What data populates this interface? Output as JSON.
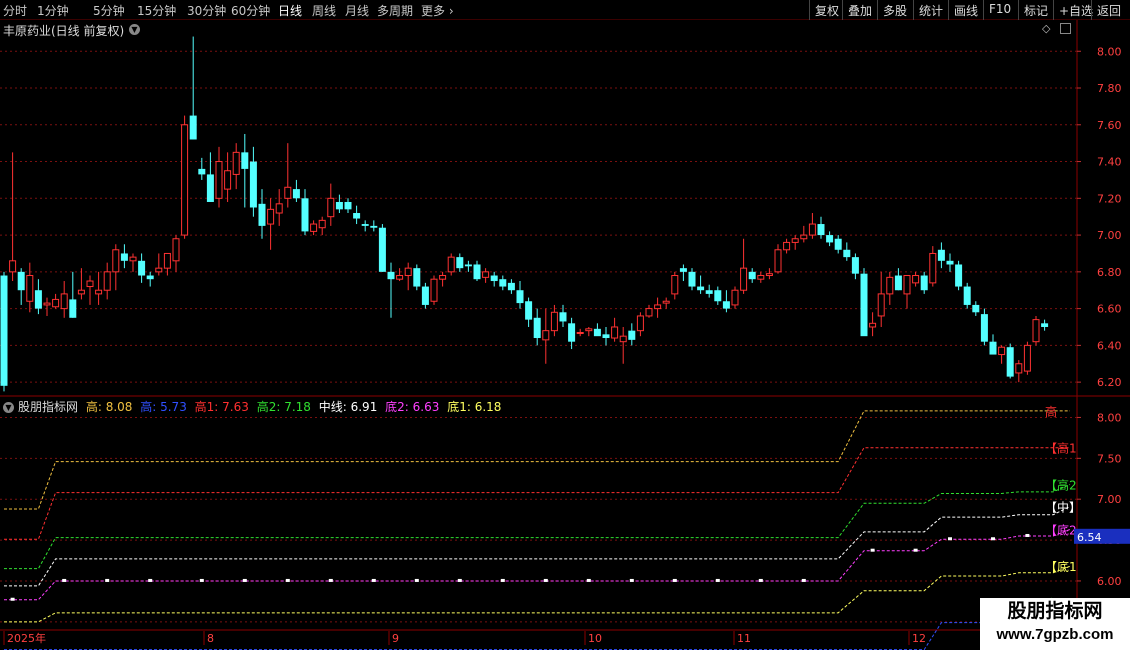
{
  "toolbar": {
    "periods": [
      "分时",
      "1分钟",
      "5分钟",
      "15分钟",
      "30分钟",
      "60分钟",
      "日线",
      "周线",
      "月线",
      "多周期",
      "更多"
    ],
    "active_period": "日线",
    "buttons": [
      "复权",
      "叠加",
      "多股",
      "统计",
      "画线",
      "F10",
      "标记",
      "+自选",
      "返回"
    ]
  },
  "main_chart": {
    "title": "丰原药业(日线 前复权)",
    "price_axis": [
      "8.00",
      "7.80",
      "7.60",
      "7.40",
      "7.20",
      "7.00",
      "6.80",
      "6.60",
      "6.40",
      "6.20"
    ]
  },
  "indicator": {
    "name": "股朋指标网",
    "legend": [
      {
        "label": "高: 8.08",
        "color": "#f0c040"
      },
      {
        "label": "高: 5.73",
        "color": "#3050ff"
      },
      {
        "label": "高1: 7.63",
        "color": "#ff3030"
      },
      {
        "label": "高2: 7.18",
        "color": "#30e030"
      },
      {
        "label": "中线: 6.91",
        "color": "#ffffff"
      },
      {
        "label": "底2: 6.63",
        "color": "#ff40ff"
      },
      {
        "label": "底1: 6.18",
        "color": "#ffff60"
      }
    ],
    "axis": [
      "8.00",
      "7.50",
      "7.00",
      "6.50",
      "6.00",
      "5.50"
    ],
    "line_tags": [
      {
        "text": "高",
        "color": "#ff3030",
        "value": 8.08
      },
      {
        "text": "【高1",
        "color": "#ff3030",
        "value": 7.63
      },
      {
        "text": "【高2",
        "color": "#30e030",
        "value": 7.18
      },
      {
        "text": "【中】",
        "color": "#ffffff",
        "value": 6.91
      },
      {
        "text": "【底2",
        "color": "#ff40ff",
        "value": 6.63
      },
      {
        "text": "【底1",
        "color": "#ffff60",
        "value": 6.18
      },
      {
        "text": "底",
        "color": "#30e030",
        "value": 5.73
      }
    ],
    "current_value": "6.54"
  },
  "time_axis": {
    "labels": [
      "2025年",
      "8",
      "9",
      "10",
      "11",
      "12"
    ]
  },
  "watermark": {
    "name": "股朋指标网",
    "url": "www.7gpzb.com"
  },
  "chart_data": [
    {
      "type": "candlestick",
      "title": "丰原药业(日线 前复权)",
      "ylim": [
        6.13,
        8.17
      ],
      "y_ticks": [
        8.0,
        7.8,
        7.6,
        7.4,
        7.2,
        7.0,
        6.8,
        6.6,
        6.4,
        6.2
      ],
      "x_labels": [
        "2025年",
        "8",
        "9",
        "10",
        "11",
        "12"
      ],
      "up_color": "#ff3232",
      "down_color": "#54ffff",
      "ohlc": [
        [
          6.78,
          6.8,
          6.15,
          6.18
        ],
        [
          6.8,
          7.45,
          6.75,
          6.86
        ],
        [
          6.8,
          6.82,
          6.62,
          6.7
        ],
        [
          6.64,
          6.85,
          6.58,
          6.78
        ],
        [
          6.7,
          6.76,
          6.57,
          6.6
        ],
        [
          6.62,
          6.66,
          6.56,
          6.63
        ],
        [
          6.61,
          6.68,
          6.6,
          6.65
        ],
        [
          6.6,
          6.75,
          6.55,
          6.68
        ],
        [
          6.65,
          6.8,
          6.55,
          6.55
        ],
        [
          6.68,
          6.82,
          6.65,
          6.7
        ],
        [
          6.72,
          6.78,
          6.62,
          6.75
        ],
        [
          6.68,
          6.8,
          6.62,
          6.7
        ],
        [
          6.7,
          6.85,
          6.65,
          6.8
        ],
        [
          6.8,
          6.95,
          6.7,
          6.92
        ],
        [
          6.9,
          6.95,
          6.82,
          6.86
        ],
        [
          6.86,
          6.9,
          6.8,
          6.88
        ],
        [
          6.86,
          6.9,
          6.74,
          6.78
        ],
        [
          6.78,
          6.8,
          6.72,
          6.76
        ],
        [
          6.8,
          6.9,
          6.78,
          6.82
        ],
        [
          6.82,
          6.9,
          6.78,
          6.9
        ],
        [
          6.86,
          7.0,
          6.8,
          6.98
        ],
        [
          7.0,
          7.65,
          6.98,
          7.6
        ],
        [
          7.65,
          8.08,
          7.52,
          7.52
        ],
        [
          7.36,
          7.42,
          7.3,
          7.33
        ],
        [
          7.33,
          7.45,
          7.18,
          7.18
        ],
        [
          7.2,
          7.48,
          7.15,
          7.4
        ],
        [
          7.25,
          7.45,
          7.18,
          7.35
        ],
        [
          7.33,
          7.5,
          7.25,
          7.45
        ],
        [
          7.45,
          7.55,
          7.15,
          7.36
        ],
        [
          7.4,
          7.48,
          7.1,
          7.15
        ],
        [
          7.17,
          7.25,
          6.98,
          7.05
        ],
        [
          7.06,
          7.2,
          6.92,
          7.14
        ],
        [
          7.12,
          7.25,
          7.05,
          7.17
        ],
        [
          7.2,
          7.5,
          7.15,
          7.26
        ],
        [
          7.25,
          7.3,
          7.18,
          7.2
        ],
        [
          7.2,
          7.25,
          7.0,
          7.02
        ],
        [
          7.02,
          7.08,
          7.0,
          7.06
        ],
        [
          7.04,
          7.1,
          7.0,
          7.08
        ],
        [
          7.1,
          7.28,
          7.05,
          7.2
        ],
        [
          7.18,
          7.22,
          7.12,
          7.14
        ],
        [
          7.18,
          7.2,
          7.12,
          7.14
        ],
        [
          7.12,
          7.16,
          7.06,
          7.09
        ],
        [
          7.06,
          7.08,
          7.02,
          7.05
        ],
        [
          7.05,
          7.08,
          7.02,
          7.04
        ],
        [
          7.04,
          7.06,
          6.8,
          6.8
        ],
        [
          6.8,
          6.85,
          6.55,
          6.76
        ],
        [
          6.76,
          6.82,
          6.75,
          6.78
        ],
        [
          6.78,
          6.85,
          6.7,
          6.82
        ],
        [
          6.82,
          6.84,
          6.7,
          6.72
        ],
        [
          6.72,
          6.74,
          6.6,
          6.62
        ],
        [
          6.64,
          6.78,
          6.62,
          6.76
        ],
        [
          6.76,
          6.8,
          6.72,
          6.78
        ],
        [
          6.8,
          6.9,
          6.78,
          6.88
        ],
        [
          6.88,
          6.9,
          6.8,
          6.82
        ],
        [
          6.84,
          6.86,
          6.8,
          6.83
        ],
        [
          6.84,
          6.86,
          6.75,
          6.76
        ],
        [
          6.77,
          6.82,
          6.74,
          6.8
        ],
        [
          6.78,
          6.8,
          6.72,
          6.75
        ],
        [
          6.76,
          6.78,
          6.7,
          6.72
        ],
        [
          6.74,
          6.76,
          6.68,
          6.7
        ],
        [
          6.7,
          6.75,
          6.6,
          6.63
        ],
        [
          6.64,
          6.66,
          6.5,
          6.54
        ],
        [
          6.55,
          6.6,
          6.4,
          6.44
        ],
        [
          6.43,
          6.6,
          6.3,
          6.48
        ],
        [
          6.48,
          6.62,
          6.45,
          6.58
        ],
        [
          6.58,
          6.62,
          6.5,
          6.53
        ],
        [
          6.52,
          6.55,
          6.38,
          6.42
        ],
        [
          6.47,
          6.49,
          6.45,
          6.47
        ],
        [
          6.48,
          6.5,
          6.45,
          6.49
        ],
        [
          6.49,
          6.52,
          6.46,
          6.45
        ],
        [
          6.46,
          6.5,
          6.4,
          6.44
        ],
        [
          6.44,
          6.55,
          6.42,
          6.5
        ],
        [
          6.42,
          6.5,
          6.3,
          6.45
        ],
        [
          6.48,
          6.52,
          6.4,
          6.43
        ],
        [
          6.48,
          6.58,
          6.45,
          6.56
        ],
        [
          6.56,
          6.62,
          6.55,
          6.6
        ],
        [
          6.6,
          6.66,
          6.55,
          6.62
        ],
        [
          6.63,
          6.66,
          6.6,
          6.64
        ],
        [
          6.68,
          6.8,
          6.65,
          6.78
        ],
        [
          6.82,
          6.84,
          6.75,
          6.8
        ],
        [
          6.8,
          6.82,
          6.7,
          6.72
        ],
        [
          6.72,
          6.78,
          6.68,
          6.7
        ],
        [
          6.7,
          6.73,
          6.66,
          6.68
        ],
        [
          6.7,
          6.72,
          6.62,
          6.64
        ],
        [
          6.64,
          6.7,
          6.58,
          6.6
        ],
        [
          6.62,
          6.72,
          6.6,
          6.7
        ],
        [
          6.7,
          6.98,
          6.68,
          6.82
        ],
        [
          6.8,
          6.82,
          6.74,
          6.76
        ],
        [
          6.76,
          6.8,
          6.74,
          6.78
        ],
        [
          6.78,
          6.82,
          6.76,
          6.79
        ],
        [
          6.8,
          6.95,
          6.79,
          6.92
        ],
        [
          6.92,
          6.98,
          6.9,
          6.96
        ],
        [
          6.96,
          7.0,
          6.92,
          6.98
        ],
        [
          6.98,
          7.05,
          6.96,
          7.0
        ],
        [
          7.0,
          7.12,
          6.98,
          7.06
        ],
        [
          7.06,
          7.1,
          6.98,
          7.0
        ],
        [
          7.0,
          7.02,
          6.94,
          6.96
        ],
        [
          6.98,
          7.0,
          6.9,
          6.92
        ],
        [
          6.92,
          6.96,
          6.86,
          6.88
        ],
        [
          6.88,
          6.9,
          6.76,
          6.79
        ],
        [
          6.79,
          6.82,
          6.48,
          6.45
        ],
        [
          6.5,
          6.58,
          6.45,
          6.52
        ],
        [
          6.56,
          6.8,
          6.5,
          6.68
        ],
        [
          6.68,
          6.8,
          6.62,
          6.77
        ],
        [
          6.78,
          6.82,
          6.7,
          6.7
        ],
        [
          6.68,
          6.78,
          6.6,
          6.78
        ],
        [
          6.74,
          6.8,
          6.72,
          6.78
        ],
        [
          6.78,
          6.8,
          6.68,
          6.7
        ],
        [
          6.74,
          6.94,
          6.72,
          6.9
        ],
        [
          6.92,
          6.96,
          6.82,
          6.86
        ],
        [
          6.86,
          6.9,
          6.8,
          6.84
        ],
        [
          6.84,
          6.86,
          6.7,
          6.72
        ],
        [
          6.72,
          6.74,
          6.6,
          6.62
        ],
        [
          6.62,
          6.64,
          6.56,
          6.58
        ],
        [
          6.57,
          6.6,
          6.4,
          6.42
        ],
        [
          6.42,
          6.46,
          6.35,
          6.35
        ],
        [
          6.35,
          6.4,
          6.3,
          6.39
        ],
        [
          6.39,
          6.41,
          6.22,
          6.23
        ],
        [
          6.25,
          6.32,
          6.2,
          6.3
        ],
        [
          6.26,
          6.42,
          6.24,
          6.4
        ],
        [
          6.42,
          6.56,
          6.4,
          6.54
        ],
        [
          6.52,
          6.54,
          6.48,
          6.5
        ]
      ]
    },
    {
      "type": "line",
      "title": "股朋指标网",
      "ylim": [
        5.4,
        8.25
      ],
      "y_ticks": [
        8.0,
        7.5,
        7.0,
        6.5,
        6.0,
        5.5
      ],
      "segments": [
        {
          "from": 0,
          "to": 4
        },
        {
          "from": 6,
          "to": 19
        },
        {
          "from": 22,
          "to": 97
        },
        {
          "from": 100,
          "to": 107
        },
        {
          "from": 109,
          "to": 116
        },
        {
          "from": 118,
          "to": 122
        }
      ],
      "series": [
        {
          "name": "高",
          "color": "#f0c040",
          "values": [
            6.88,
            7.46,
            7.46,
            8.08,
            8.08,
            8.08,
            8.08,
            8.08
          ]
        },
        {
          "name": "高1",
          "color": "#ff3030",
          "values": [
            6.51,
            7.08,
            7.08,
            7.63,
            7.63,
            7.63,
            7.63,
            7.63
          ]
        },
        {
          "name": "高2",
          "color": "#30e030",
          "values": [
            6.15,
            6.53,
            6.53,
            6.95,
            7.07,
            7.09,
            7.16,
            7.18
          ]
        },
        {
          "name": "中线",
          "color": "#ffffff",
          "values": [
            5.94,
            6.27,
            6.27,
            6.6,
            6.78,
            6.81,
            6.88,
            6.91
          ]
        },
        {
          "name": "底2",
          "color": "#ff40ff",
          "values": [
            5.77,
            6.0,
            6.0,
            6.37,
            6.51,
            6.55,
            6.6,
            6.63
          ]
        },
        {
          "name": "底1",
          "color": "#ffff60",
          "values": [
            5.5,
            5.61,
            5.61,
            5.88,
            6.06,
            6.1,
            6.15,
            6.18
          ]
        },
        {
          "name": "底",
          "color": "#3050ff",
          "values": [
            5.16,
            5.16,
            5.16,
            5.16,
            5.49,
            5.55,
            5.69,
            5.73
          ]
        }
      ],
      "step_index": [
        0,
        20,
        23,
        106,
        108,
        117,
        119,
        124
      ]
    }
  ]
}
